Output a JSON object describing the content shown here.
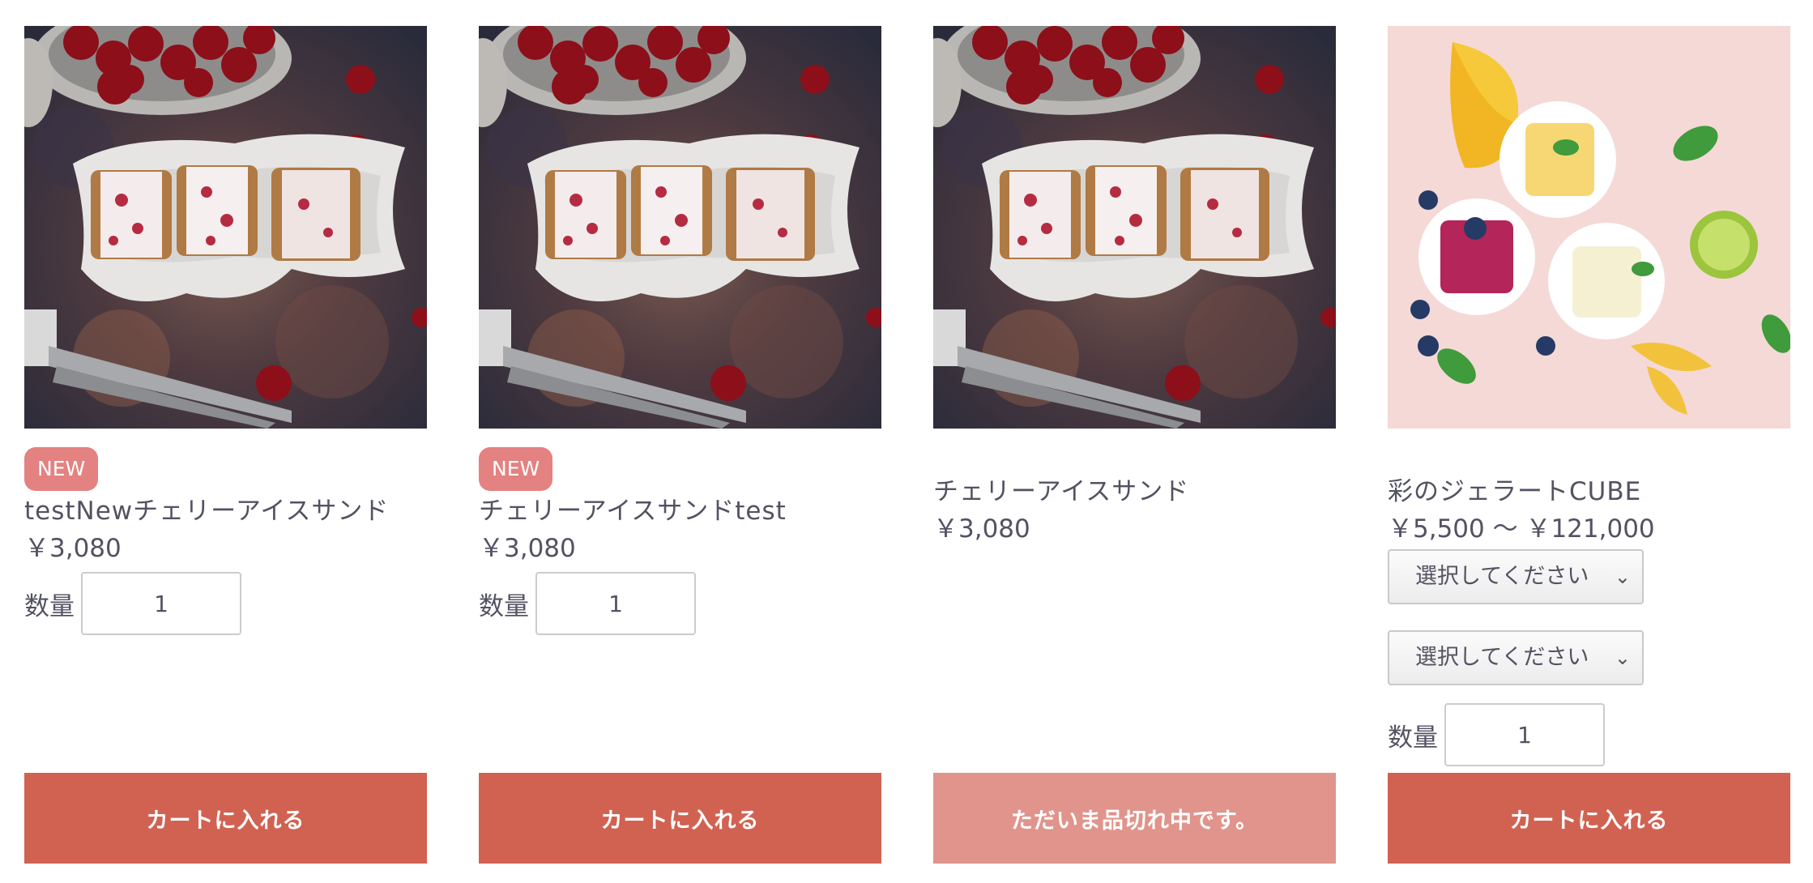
{
  "products": [
    {
      "image": "cherry-ice-sandwich",
      "badge": "NEW",
      "name": "testNewチェリーアイスサンド",
      "price": "￥3,080",
      "qty_label": "数量",
      "qty_value": "1",
      "button_label": "カートに入れる"
    },
    {
      "image": "cherry-ice-sandwich",
      "badge": "NEW",
      "name": "チェリーアイスサンドtest",
      "price": "￥3,080",
      "qty_label": "数量",
      "qty_value": "1",
      "button_label": "カートに入れる"
    },
    {
      "image": "cherry-ice-sandwich",
      "name": "チェリーアイスサンド",
      "price": "￥3,080",
      "button_label": "ただいま品切れ中です。"
    },
    {
      "image": "gelato-cube",
      "name": "彩のジェラートCUBE",
      "price": "￥5,500 ～ ￥121,000",
      "select1": "選択してください",
      "select2": "選択してください",
      "qty_label": "数量",
      "qty_value": "1",
      "button_label": "カートに入れる"
    }
  ],
  "colors": {
    "text": "#525263",
    "badge": "#e48181",
    "button": "#d16252",
    "button_disabled": "#e0948c"
  }
}
